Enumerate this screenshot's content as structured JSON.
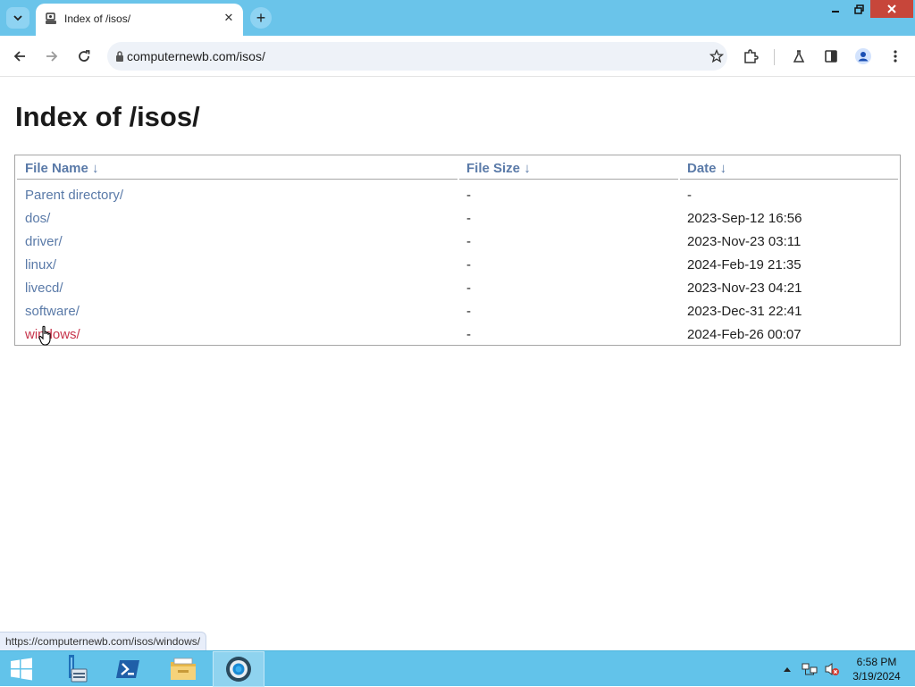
{
  "browser": {
    "tab": {
      "title": "Index of /isos/",
      "close_glyph": "✕"
    },
    "new_tab_glyph": "+",
    "address": {
      "url": "computernewb.com/isos/"
    }
  },
  "page": {
    "title": "Index of /isos/",
    "table": {
      "headers": [
        "File Name  ↓",
        "File Size  ↓",
        "Date  ↓"
      ],
      "rows": [
        {
          "name": "Parent directory/",
          "size": "-",
          "date": "-"
        },
        {
          "name": "dos/",
          "size": "-",
          "date": "2023-Sep-12 16:56"
        },
        {
          "name": "driver/",
          "size": "-",
          "date": "2023-Nov-23 03:11"
        },
        {
          "name": "linux/",
          "size": "-",
          "date": "2024-Feb-19 21:35"
        },
        {
          "name": "livecd/",
          "size": "-",
          "date": "2023-Nov-23 04:21"
        },
        {
          "name": "software/",
          "size": "-",
          "date": "2023-Dec-31 22:41"
        },
        {
          "name": "windows/",
          "size": "-",
          "date": "2024-Feb-26 00:07"
        }
      ]
    }
  },
  "status_bar": {
    "link_preview": "https://computernewb.com/isos/windows/"
  },
  "taskbar": {
    "clock": {
      "time": "6:58 PM",
      "date": "3/19/2024"
    }
  },
  "colors": {
    "tab_strip": "#6ac4ea",
    "link": "#5a7aa8",
    "link_hover": "#c7344b",
    "taskbar": "#62c3ea"
  },
  "icons": [
    "tab-search-icon",
    "favicon-icon",
    "close-icon",
    "plus-icon",
    "minimize-icon",
    "restore-icon",
    "window-close-icon",
    "back-icon",
    "forward-icon",
    "reload-icon",
    "lock-icon",
    "star-icon",
    "extensions-icon",
    "labs-icon",
    "side-panel-icon",
    "profile-icon",
    "menu-icon",
    "windows-start-icon",
    "server-manager-icon",
    "powershell-icon",
    "file-explorer-icon",
    "chrome-icon",
    "tray-overflow-icon",
    "network-icon",
    "volume-muted-icon"
  ]
}
